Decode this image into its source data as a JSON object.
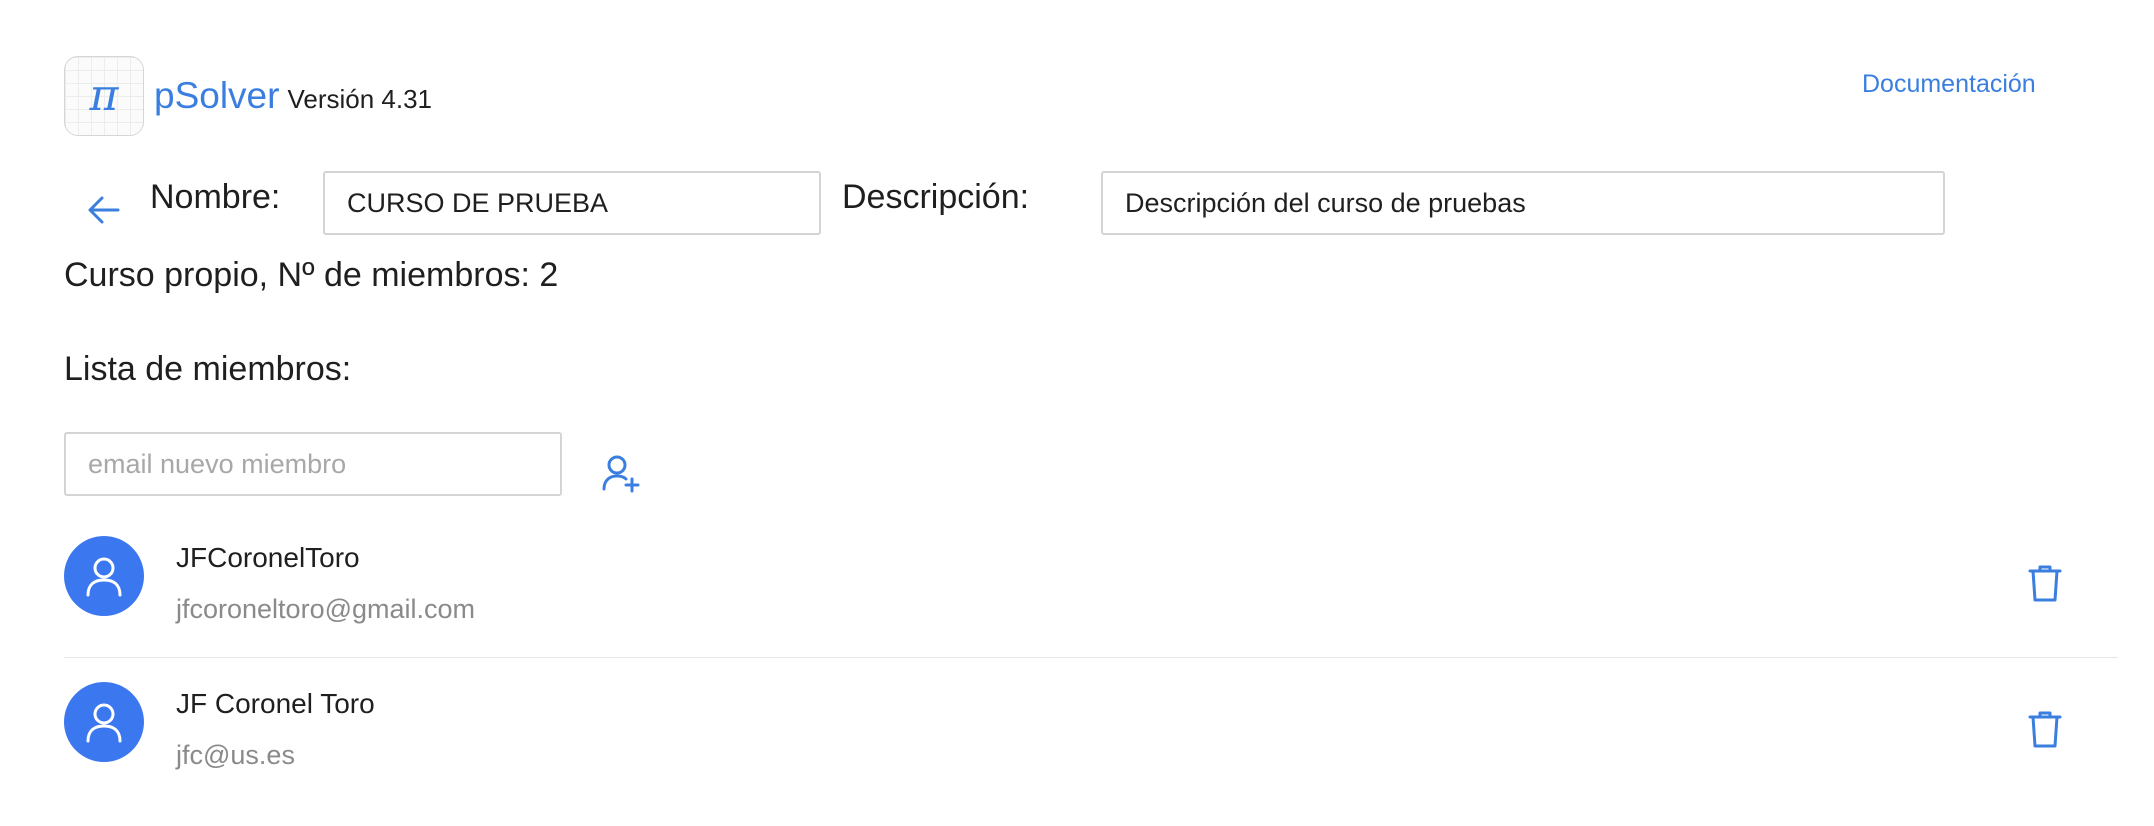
{
  "app": {
    "logo_glyph": "π",
    "name": "pSolver",
    "version": "Versión 4.31",
    "documentation_link": "Documentación",
    "accent_color": "#3a7fe0"
  },
  "course": {
    "name_label": "Nombre:",
    "name_value": "CURSO DE PRUEBA",
    "description_label": "Descripción:",
    "description_value": "Descripción del curso de pruebas",
    "info": "Curso propio, Nº de miembros: 2"
  },
  "members": {
    "title": "Lista de miembros:",
    "new_member_placeholder": "email nuevo miembro",
    "list": [
      {
        "name": "JFCoronelToro",
        "email": "jfcoroneltoro@gmail.com"
      },
      {
        "name": "JF Coronel Toro",
        "email": "jfc@us.es"
      }
    ]
  },
  "icons": {
    "back": "arrow-left-icon",
    "add_member": "user-plus-icon",
    "avatar": "user-icon",
    "delete": "trash-icon"
  }
}
